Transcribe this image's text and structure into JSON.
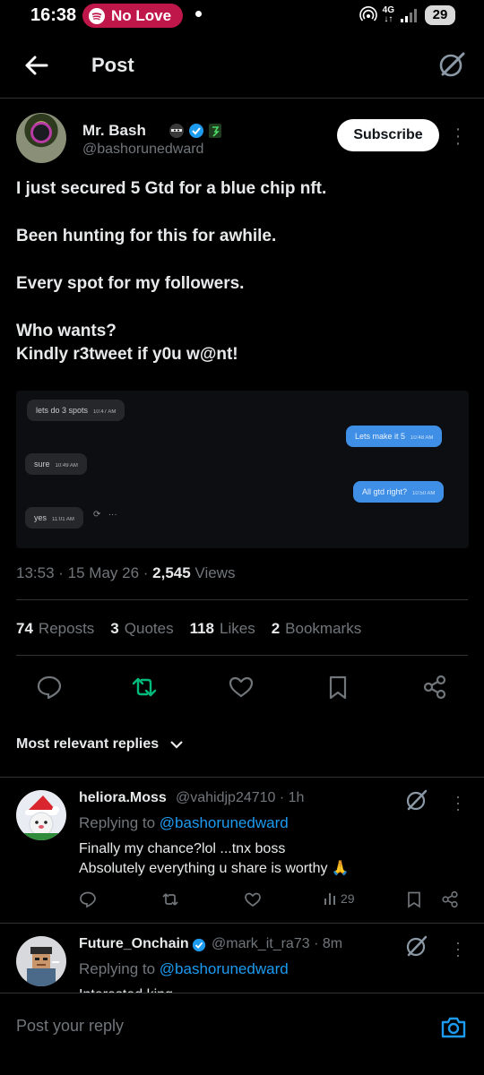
{
  "status_bar": {
    "time": "16:38",
    "spotify_label": "No Love",
    "network_top": "4G",
    "network_bottom": "↓↑",
    "battery": "29"
  },
  "header": {
    "title": "Post"
  },
  "post": {
    "author_name": "Mr. Bash",
    "author_handle": "@bashorunedward",
    "subscribe_label": "Subscribe",
    "text_lines": [
      "I just secured 5 Gtd for a blue chip nft.",
      "",
      "Been hunting for this for awhile.",
      "",
      "Every spot for my followers.",
      "",
      "Who wants?",
      "Kindly r3tweet if y0u w@nt!"
    ],
    "media_messages": [
      {
        "side": "left",
        "text": "lets do 3 spots",
        "time": "10:47 AM"
      },
      {
        "side": "right",
        "text": "Lets make it 5",
        "time": "10:48 AM"
      },
      {
        "side": "left",
        "text": "sure",
        "time": "10:49 AM"
      },
      {
        "side": "right",
        "text": "All gtd right?",
        "time": "10:50 AM"
      },
      {
        "side": "left",
        "text": "yes",
        "time": "11:01 AM"
      }
    ],
    "timestamp": "13:53 · 15 May 26 · ",
    "views_count": "2,545",
    "views_label": " Views",
    "stats": [
      {
        "count": "74",
        "label": "Reposts"
      },
      {
        "count": "3",
        "label": "Quotes"
      },
      {
        "count": "118",
        "label": "Likes"
      },
      {
        "count": "2",
        "label": "Bookmarks"
      }
    ]
  },
  "replies_header": {
    "label": "Most relevant replies"
  },
  "replies": [
    {
      "name": "heliora.Moss",
      "handle": "@vahidjp24710 · 1h",
      "replying_prefix": "Replying to ",
      "replying_to": "@bashorunedward",
      "text_lines": [
        "Finally my chance?lol ...tnx boss",
        "Absolutely everything u share is worthy 🙏"
      ],
      "views": "29"
    },
    {
      "name": "Future_Onchain",
      "handle": "@mark_it_ra73 · 8m",
      "replying_prefix": "Replying to ",
      "replying_to": "@bashorunedward",
      "text_lines": [
        "Interested king"
      ]
    }
  ],
  "compose": {
    "placeholder": "Post your reply"
  },
  "colors": {
    "accent": "#1d9bf0",
    "repost_active": "#00ba7c",
    "spotify_pill": "#c0174a"
  }
}
